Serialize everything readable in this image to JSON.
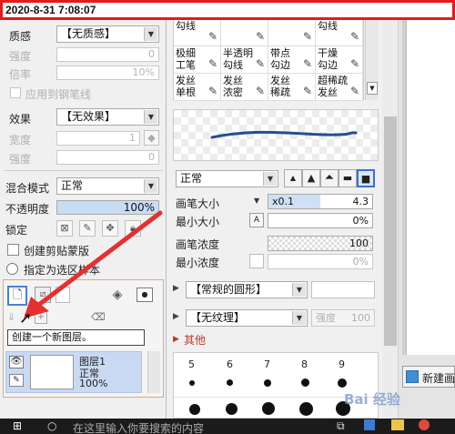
{
  "timestamp": "2020-8-31 7:08:07",
  "left_panel": {
    "texture": {
      "label": "质感",
      "value": "【无质感】"
    },
    "strength": {
      "label": "强度",
      "value": "0"
    },
    "scale": {
      "label": "倍率",
      "value": "10%"
    },
    "apply_to_pen": "应用到钢笔线",
    "effect": {
      "label": "效果",
      "value": "【无效果】"
    },
    "width": {
      "label": "宽度",
      "value": "1"
    },
    "effect_strength": {
      "label": "强度",
      "value": "0"
    },
    "blend_mode": {
      "label": "混合模式",
      "value": "正常"
    },
    "opacity": {
      "label": "不透明度",
      "value": "100%"
    },
    "lock_label": "锁定",
    "clipping_group": "创建剪贴蒙版",
    "specify_selection": "指定为选区样本",
    "tooltip": "创建一个新图层。",
    "layer": {
      "name": "图层1",
      "mode": "正常",
      "opacity": "100%"
    }
  },
  "brush_grid": [
    [
      "勾线",
      "",
      "",
      "勾线"
    ],
    [
      "极细\n工笔",
      "半透明\n勾线",
      "带点\n勾边",
      "干燥\n勾边"
    ],
    [
      "发丝\n单根",
      "发丝\n浓密",
      "发丝\n稀疏",
      "超稀疏\n发丝"
    ]
  ],
  "tool_settings": {
    "blend_mode": "正常",
    "brush_size": {
      "label": "画笔大小",
      "multiplier": "x0.1",
      "value": "4.3"
    },
    "min_size": {
      "label": "最小大小",
      "value": "0%"
    },
    "brush_density": {
      "label": "画笔浓度",
      "value": "100"
    },
    "min_density": {
      "label": "最小浓度",
      "value": "0%"
    },
    "shape": "【常规的圆形】",
    "texture": "【无纹理】",
    "texture_strength": {
      "label": "强度",
      "value": "100"
    },
    "other_label": "其他",
    "dot_sizes": [
      "5",
      "6",
      "7",
      "8",
      "9"
    ]
  },
  "right_panel": {
    "new_canvas_label": "新建画"
  },
  "taskbar": {
    "search_placeholder": "在这里输入你要搜索的内容"
  },
  "watermark": "Bai 经验",
  "colors": {
    "highlight_red": "#e21b1b",
    "layer_selected": "#c9d9f2",
    "slider_blue": "#c9dcf5"
  }
}
